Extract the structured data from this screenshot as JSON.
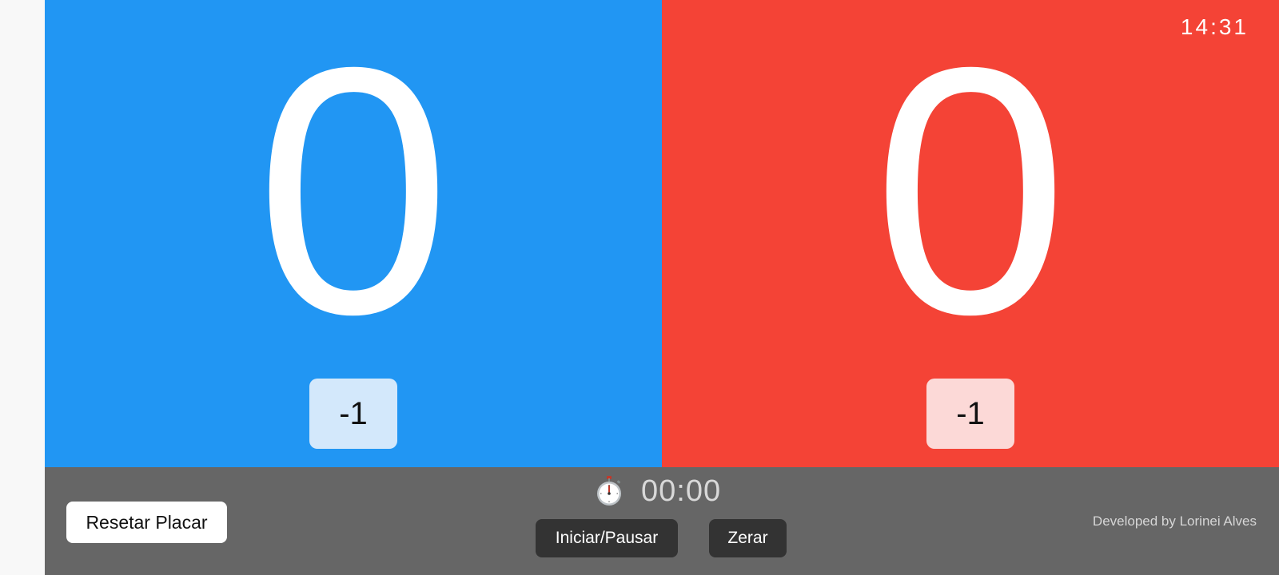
{
  "clock": "14:31",
  "teams": [
    {
      "name": "blue",
      "score": "0",
      "minus_label": "-1",
      "color": "#2196f3"
    },
    {
      "name": "red",
      "score": "0",
      "minus_label": "-1",
      "color": "#f44336"
    }
  ],
  "footer": {
    "reset_label": "Resetar Placar",
    "timer_icon": "stopwatch-icon",
    "timer_value": "00:00",
    "start_pause_label": "Iniciar/Pausar",
    "zero_label": "Zerar",
    "credit": "Developed by Lorinei Alves",
    "background": "#666666"
  }
}
